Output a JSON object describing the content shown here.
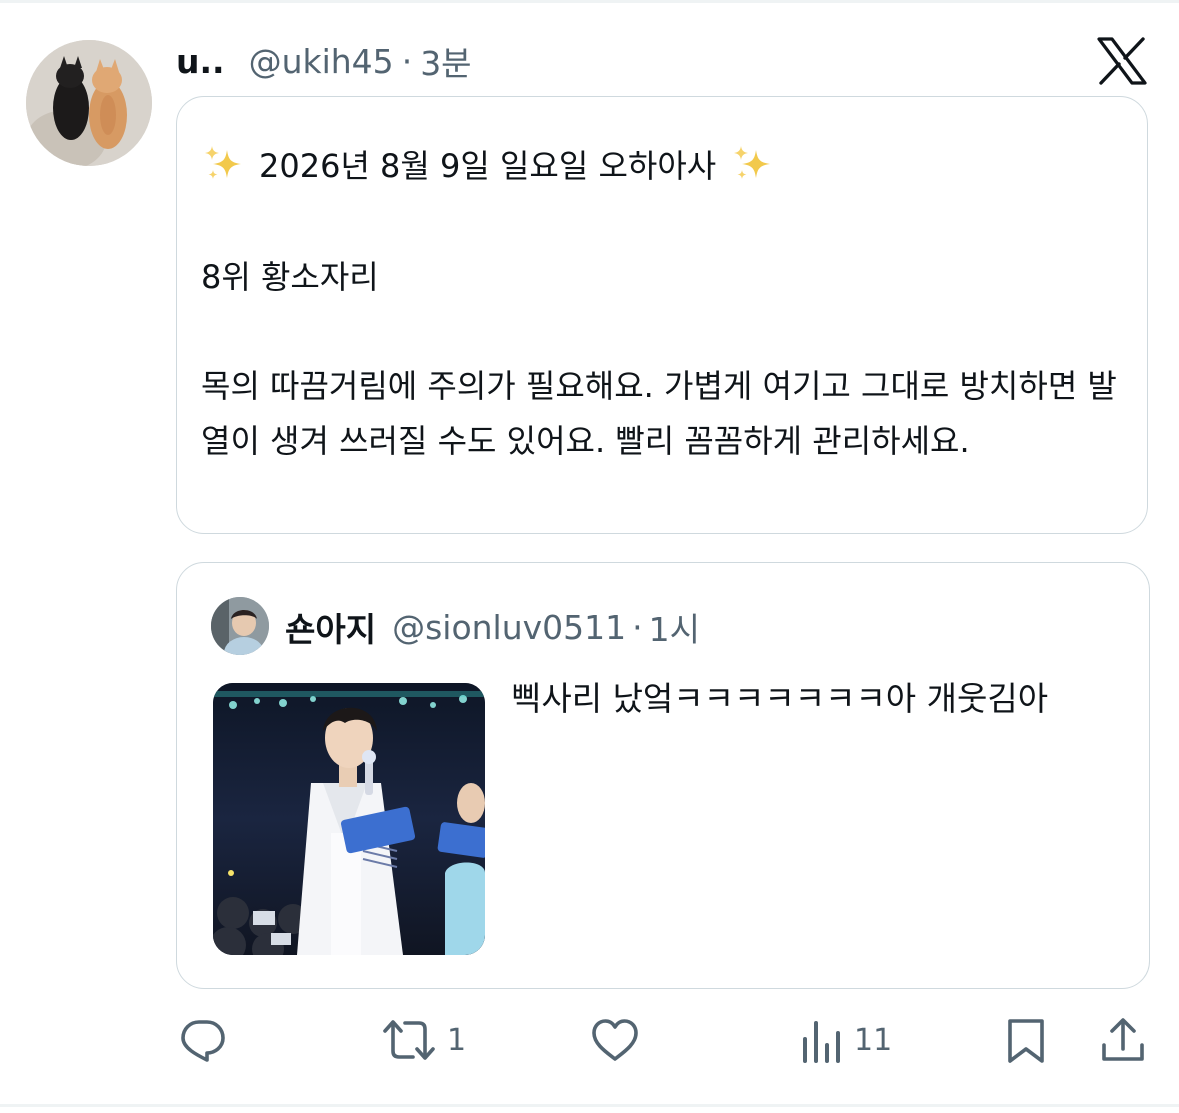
{
  "post": {
    "display_name": "u..",
    "handle": "@ukih45",
    "separator": "·",
    "time": "3분",
    "card": {
      "title": "2026년 8월 9일 일요일 오하아사",
      "rank": "8위 황소자리",
      "body": "목의 따끔거림에 주의가 필요해요. 가볍게 여기고 그대로 방치하면 발열이 생겨 쓰러질 수도 있어요. 빨리 꼼꼼하게 관리하세요."
    }
  },
  "quote": {
    "display_name": "숀아지",
    "handle": "@sionluv0511",
    "separator": "·",
    "time": "1시",
    "text": "삑사리 났엌ㅋㅋㅋㅋㅋㅋㅋ아 개웃김아"
  },
  "actions": {
    "reply_count": "",
    "repost_count": "1",
    "like_count": "",
    "views_count": "11"
  },
  "icons": {
    "logo": "x-logo-icon",
    "sparkle": "sparkles-icon",
    "reply": "reply-icon",
    "repost": "repost-icon",
    "like": "heart-icon",
    "views": "views-icon",
    "bookmark": "bookmark-icon",
    "share": "share-icon"
  },
  "colors": {
    "text_primary": "#0f1419",
    "text_secondary": "#536471",
    "border": "#cfd9de",
    "sparkle": "#f2c94c"
  }
}
